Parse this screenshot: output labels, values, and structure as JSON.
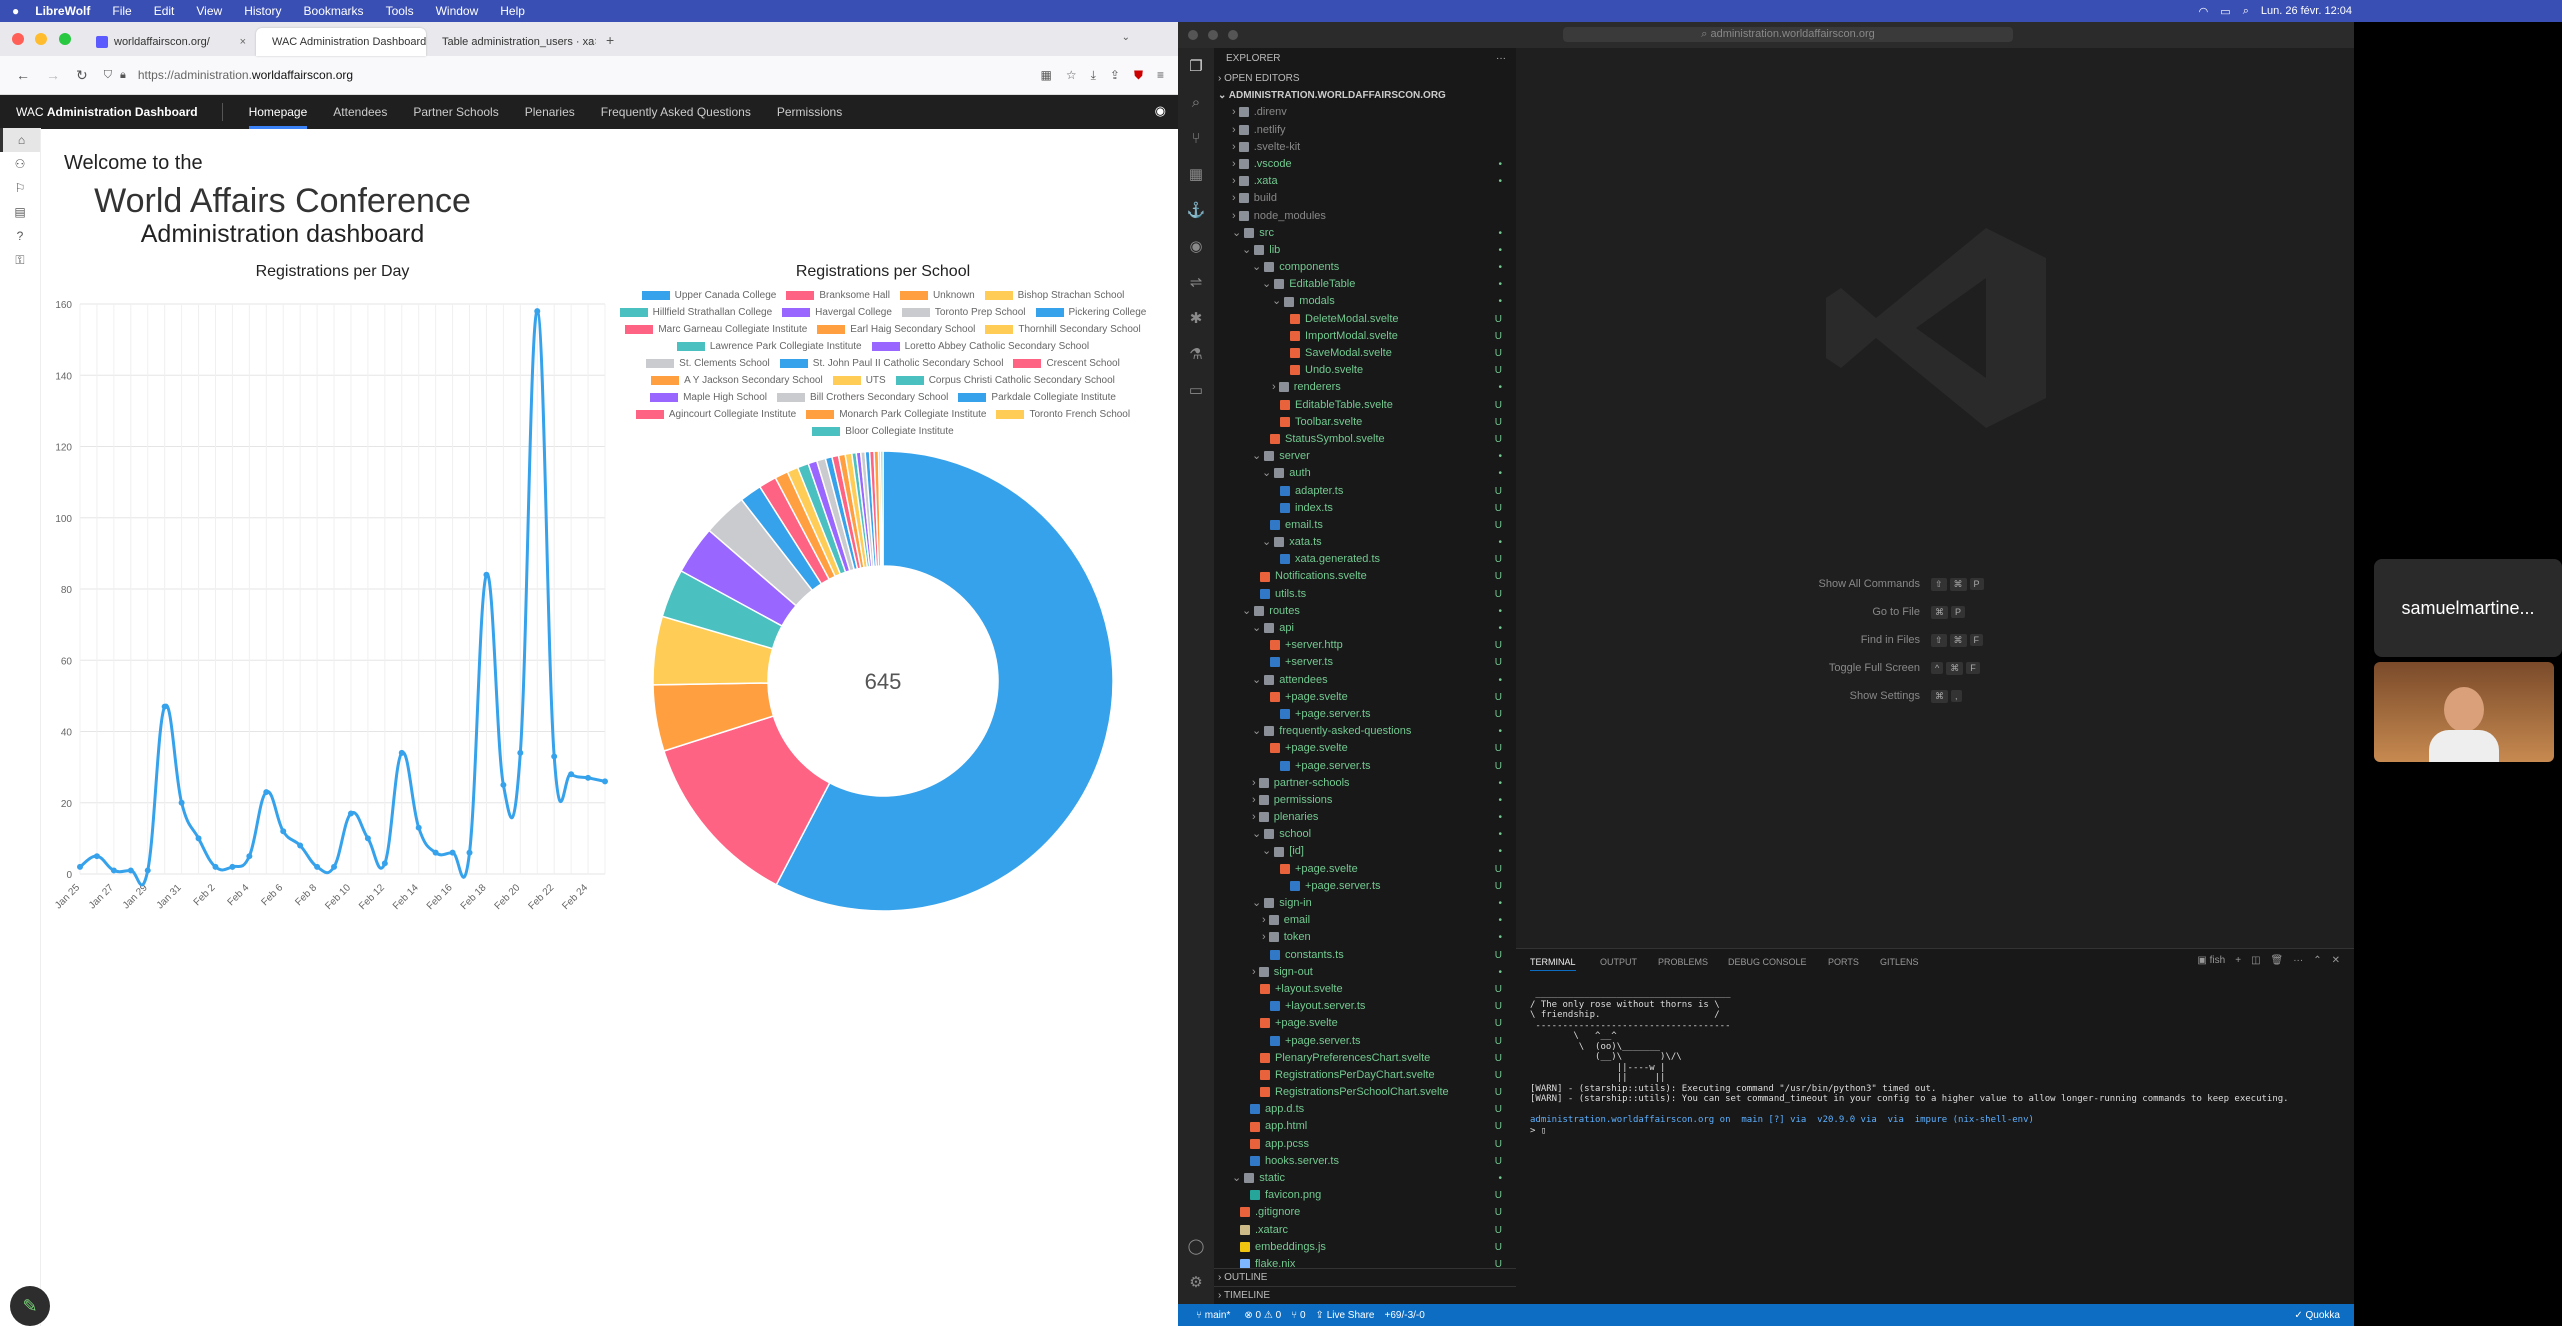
{
  "menubar": {
    "app": "LibreWolf",
    "items": [
      "File",
      "Edit",
      "View",
      "History",
      "Bookmarks",
      "Tools",
      "Window",
      "Help"
    ],
    "clock": "Lun. 26 févr. 12:04"
  },
  "browser": {
    "tabs": [
      {
        "title": "worldaffairscon.org/",
        "active": false
      },
      {
        "title": "WAC Administration Dashboard",
        "active": true
      },
      {
        "title": "Table administration_users · xa",
        "active": false
      }
    ],
    "url_prefix": "https://administration.",
    "url_domain": "worldaffairscon.org"
  },
  "app": {
    "brand_prefix": "WAC ",
    "brand_bold": "Administration Dashboard",
    "nav": [
      "Homepage",
      "Attendees",
      "Partner Schools",
      "Plenaries",
      "Frequently Asked Questions",
      "Permissions"
    ],
    "welcome": "Welcome to the",
    "conference": "World Affairs Conference",
    "dashboard": "Administration dashboard"
  },
  "chart_data": [
    {
      "type": "line",
      "title": "Registrations per Day",
      "x": [
        "Jan 25",
        "Jan 26",
        "Jan 27",
        "Jan 28",
        "Jan 29",
        "Jan 30",
        "Jan 31",
        "Feb 1",
        "Feb 2",
        "Feb 3",
        "Feb 4",
        "Feb 5",
        "Feb 6",
        "Feb 7",
        "Feb 8",
        "Feb 9",
        "Feb 10",
        "Feb 11",
        "Feb 12",
        "Feb 13",
        "Feb 14",
        "Feb 15",
        "Feb 16",
        "Feb 17",
        "Feb 18",
        "Feb 19",
        "Feb 20",
        "Feb 21",
        "Feb 22",
        "Feb 23",
        "Feb 24",
        "Feb 25"
      ],
      "x_tick_labels": [
        "Jan 25",
        "Jan 27",
        "Jan 29",
        "Jan 31",
        "Feb 2",
        "Feb 4",
        "Feb 6",
        "Feb 8",
        "Feb 10",
        "Feb 12",
        "Feb 14",
        "Feb 16",
        "Feb 18",
        "Feb 20",
        "Feb 22",
        "Feb 24"
      ],
      "values": [
        2,
        5,
        1,
        1,
        1,
        47,
        20,
        10,
        2,
        2,
        5,
        23,
        12,
        8,
        2,
        2,
        17,
        10,
        3,
        34,
        13,
        6,
        6,
        6,
        84,
        25,
        34,
        158,
        33,
        28,
        27,
        26
      ],
      "y_ticks": [
        "0",
        "20",
        "40",
        "60",
        "80",
        "100",
        "120",
        "140",
        "160"
      ],
      "ylim": [
        0,
        160
      ]
    },
    {
      "type": "pie",
      "title": "Registrations per School",
      "center_label": "645",
      "legend": [
        {
          "name": "Upper Canada College",
          "color": "#36a2eb",
          "value": 372
        },
        {
          "name": "Branksome Hall",
          "color": "#ff6384",
          "value": 80
        },
        {
          "name": "Unknown",
          "color": "#ff9f40",
          "value": 30
        },
        {
          "name": "Bishop Strachan School",
          "color": "#ffcd56",
          "value": 31
        },
        {
          "name": "Hillfield Strathallan College",
          "color": "#4bc0c0",
          "value": 22
        },
        {
          "name": "Havergal College",
          "color": "#9966ff",
          "value": 22
        },
        {
          "name": "Toronto Prep School",
          "color": "#c9cbcf",
          "value": 20
        },
        {
          "name": "Pickering College",
          "color": "#36a2eb",
          "value": 10
        },
        {
          "name": "Marc Garneau Collegiate Institute",
          "color": "#ff6384",
          "value": 8
        },
        {
          "name": "Earl Haig Secondary School",
          "color": "#ff9f40",
          "value": 6
        },
        {
          "name": "Thornhill Secondary School",
          "color": "#ffcd56",
          "value": 5
        },
        {
          "name": "Lawrence Park Collegiate Institute",
          "color": "#4bc0c0",
          "value": 5
        },
        {
          "name": "Loretto Abbey Catholic Secondary School",
          "color": "#9966ff",
          "value": 4
        },
        {
          "name": "St. Clements School",
          "color": "#c9cbcf",
          "value": 4
        },
        {
          "name": "St. John Paul II Catholic Secondary School",
          "color": "#36a2eb",
          "value": 3
        },
        {
          "name": "Crescent School",
          "color": "#ff6384",
          "value": 3
        },
        {
          "name": "A Y Jackson Secondary School",
          "color": "#ff9f40",
          "value": 3
        },
        {
          "name": "UTS",
          "color": "#ffcd56",
          "value": 3
        },
        {
          "name": "Corpus Christi Catholic Secondary School",
          "color": "#4bc0c0",
          "value": 2
        },
        {
          "name": "Maple High School",
          "color": "#9966ff",
          "value": 2
        },
        {
          "name": "Bill Crothers Secondary School",
          "color": "#c9cbcf",
          "value": 2
        },
        {
          "name": "Parkdale Collegiate Institute",
          "color": "#36a2eb",
          "value": 2
        },
        {
          "name": "Agincourt Collegiate Institute",
          "color": "#ff6384",
          "value": 2
        },
        {
          "name": "Monarch Park Collegiate Institute",
          "color": "#ff9f40",
          "value": 2
        },
        {
          "name": "Toronto French School",
          "color": "#ffcd56",
          "value": 1
        },
        {
          "name": "Bloor Collegiate Institute",
          "color": "#4bc0c0",
          "value": 1
        }
      ]
    }
  ],
  "vscode": {
    "title": "administration.worldaffairscon.org",
    "explorer_header": "EXPLORER",
    "open_editors": "OPEN EDITORS",
    "project": "ADMINISTRATION.WORLDAFFAIRSCON.ORG",
    "tree": [
      {
        "n": ".direnv",
        "d": 1,
        "f": true,
        "s": ""
      },
      {
        "n": ".netlify",
        "d": 1,
        "f": true,
        "s": ""
      },
      {
        "n": ".svelte-kit",
        "d": 1,
        "f": true,
        "s": ""
      },
      {
        "n": ".vscode",
        "d": 1,
        "f": true,
        "s": "•"
      },
      {
        "n": ".xata",
        "d": 1,
        "f": true,
        "s": "•"
      },
      {
        "n": "build",
        "d": 1,
        "f": true,
        "s": ""
      },
      {
        "n": "node_modules",
        "d": 1,
        "f": true,
        "s": ""
      },
      {
        "n": "src",
        "d": 1,
        "f": true,
        "s": "•",
        "open": true
      },
      {
        "n": "lib",
        "d": 2,
        "f": true,
        "s": "•",
        "open": true
      },
      {
        "n": "components",
        "d": 3,
        "f": true,
        "s": "•",
        "open": true
      },
      {
        "n": "EditableTable",
        "d": 4,
        "f": true,
        "s": "•",
        "open": true
      },
      {
        "n": "modals",
        "d": 5,
        "f": true,
        "s": "•",
        "open": true
      },
      {
        "n": "DeleteModal.svelte",
        "d": 6,
        "s": "U",
        "c": "#e8623c"
      },
      {
        "n": "ImportModal.svelte",
        "d": 6,
        "s": "U",
        "c": "#e8623c"
      },
      {
        "n": "SaveModal.svelte",
        "d": 6,
        "s": "U",
        "c": "#e8623c"
      },
      {
        "n": "Undo.svelte",
        "d": 6,
        "s": "U",
        "c": "#e8623c"
      },
      {
        "n": "renderers",
        "d": 5,
        "f": true,
        "s": "•"
      },
      {
        "n": "EditableTable.svelte",
        "d": 5,
        "s": "U",
        "c": "#e8623c"
      },
      {
        "n": "Toolbar.svelte",
        "d": 5,
        "s": "U",
        "c": "#e8623c"
      },
      {
        "n": "StatusSymbol.svelte",
        "d": 4,
        "s": "U",
        "c": "#e8623c"
      },
      {
        "n": "server",
        "d": 3,
        "f": true,
        "s": "•",
        "open": true
      },
      {
        "n": "auth",
        "d": 4,
        "f": true,
        "s": "•",
        "open": true
      },
      {
        "n": "adapter.ts",
        "d": 5,
        "s": "U",
        "c": "#3178c6"
      },
      {
        "n": "index.ts",
        "d": 5,
        "s": "U",
        "c": "#3178c6"
      },
      {
        "n": "email.ts",
        "d": 4,
        "s": "U",
        "c": "#3178c6"
      },
      {
        "n": "xata.ts",
        "d": 4,
        "f": true,
        "s": "•",
        "open": true
      },
      {
        "n": "xata.generated.ts",
        "d": 5,
        "s": "U",
        "c": "#3178c6"
      },
      {
        "n": "Notifications.svelte",
        "d": 3,
        "s": "U",
        "c": "#e8623c"
      },
      {
        "n": "utils.ts",
        "d": 3,
        "s": "U",
        "c": "#3178c6"
      },
      {
        "n": "routes",
        "d": 2,
        "f": true,
        "s": "•",
        "open": true
      },
      {
        "n": "api",
        "d": 3,
        "f": true,
        "s": "•",
        "open": true
      },
      {
        "n": "+server.http",
        "d": 4,
        "s": "U",
        "c": "#e8623c"
      },
      {
        "n": "+server.ts",
        "d": 4,
        "s": "U",
        "c": "#3178c6"
      },
      {
        "n": "attendees",
        "d": 3,
        "f": true,
        "s": "•",
        "open": true
      },
      {
        "n": "+page.svelte",
        "d": 4,
        "s": "U",
        "c": "#e8623c"
      },
      {
        "n": "+page.server.ts",
        "d": 5,
        "s": "U",
        "c": "#3178c6"
      },
      {
        "n": "frequently-asked-questions",
        "d": 3,
        "f": true,
        "s": "•",
        "open": true
      },
      {
        "n": "+page.svelte",
        "d": 4,
        "s": "U",
        "c": "#e8623c"
      },
      {
        "n": "+page.server.ts",
        "d": 5,
        "s": "U",
        "c": "#3178c6"
      },
      {
        "n": "partner-schools",
        "d": 3,
        "f": true,
        "s": "•"
      },
      {
        "n": "permissions",
        "d": 3,
        "f": true,
        "s": "•"
      },
      {
        "n": "plenaries",
        "d": 3,
        "f": true,
        "s": "•"
      },
      {
        "n": "school",
        "d": 3,
        "f": true,
        "s": "•",
        "open": true
      },
      {
        "n": "[id]",
        "d": 4,
        "f": true,
        "s": "•",
        "open": true
      },
      {
        "n": "+page.svelte",
        "d": 5,
        "s": "U",
        "c": "#e8623c"
      },
      {
        "n": "+page.server.ts",
        "d": 6,
        "s": "U",
        "c": "#3178c6"
      },
      {
        "n": "sign-in",
        "d": 3,
        "f": true,
        "s": "•",
        "open": true
      },
      {
        "n": "email",
        "d": 4,
        "f": true,
        "s": "•"
      },
      {
        "n": "token",
        "d": 4,
        "f": true,
        "s": "•"
      },
      {
        "n": "constants.ts",
        "d": 4,
        "s": "U",
        "c": "#3178c6"
      },
      {
        "n": "sign-out",
        "d": 3,
        "f": true,
        "s": "•"
      },
      {
        "n": "+layout.svelte",
        "d": 3,
        "s": "U",
        "c": "#e8623c"
      },
      {
        "n": "+layout.server.ts",
        "d": 4,
        "s": "U",
        "c": "#3178c6"
      },
      {
        "n": "+page.svelte",
        "d": 3,
        "s": "U",
        "c": "#e8623c"
      },
      {
        "n": "+page.server.ts",
        "d": 4,
        "s": "U",
        "c": "#3178c6"
      },
      {
        "n": "PlenaryPreferencesChart.svelte",
        "d": 3,
        "s": "U",
        "c": "#e8623c"
      },
      {
        "n": "RegistrationsPerDayChart.svelte",
        "d": 3,
        "s": "U",
        "c": "#e8623c"
      },
      {
        "n": "RegistrationsPerSchoolChart.svelte",
        "d": 3,
        "s": "U",
        "c": "#e8623c"
      },
      {
        "n": "app.d.ts",
        "d": 2,
        "s": "U",
        "c": "#3178c6"
      },
      {
        "n": "app.html",
        "d": 2,
        "s": "U",
        "c": "#e8623c"
      },
      {
        "n": "app.pcss",
        "d": 2,
        "s": "U",
        "c": "#e8623c"
      },
      {
        "n": "hooks.server.ts",
        "d": 2,
        "s": "U",
        "c": "#3178c6"
      },
      {
        "n": "static",
        "d": 1,
        "f": true,
        "s": "•",
        "open": true
      },
      {
        "n": "favicon.png",
        "d": 2,
        "s": "U",
        "c": "#26a69a"
      },
      {
        "n": ".gitignore",
        "d": 1,
        "s": "U",
        "c": "#e8623c"
      },
      {
        "n": ".xatarc",
        "d": 1,
        "s": "U",
        "c": "#cb8"
      },
      {
        "n": "embeddings.js",
        "d": 1,
        "s": "U",
        "c": "#f1c40f"
      },
      {
        "n": "flake.nix",
        "d": 1,
        "s": "U",
        "c": "#7eb6ff"
      }
    ],
    "outline": "OUTLINE",
    "timeline": "TIMELINE",
    "shortcuts": [
      {
        "label": "Show All Commands",
        "keys": [
          "⇧",
          "⌘",
          "P"
        ]
      },
      {
        "label": "Go to File",
        "keys": [
          "⌘",
          "P"
        ]
      },
      {
        "label": "Find in Files",
        "keys": [
          "⇧",
          "⌘",
          "F"
        ]
      },
      {
        "label": "Toggle Full Screen",
        "keys": [
          "^",
          "⌘",
          "F"
        ]
      },
      {
        "label": "Show Settings",
        "keys": [
          "⌘",
          ","
        ]
      }
    ],
    "panel_tabs": [
      "TERMINAL",
      "OUTPUT",
      "PROBLEMS",
      "DEBUG CONSOLE",
      "PORTS",
      "GITLENS"
    ],
    "terminal_shell": "fish",
    "terminal_lines": [
      " ____________________________________",
      "/ The only rose without thorns is \\",
      "\\ friendship.                     /",
      " ------------------------------------",
      "        \\   ^__^",
      "         \\  (oo)\\_______",
      "            (__)\\       )\\/\\",
      "                ||----w |",
      "                ||     ||",
      "[WARN] - (starship::utils): Executing command \"/usr/bin/python3\" timed out.",
      "[WARN] - (starship::utils): You can set command_timeout in your config to a higher value to allow longer-running commands to keep executing.",
      "",
      "administration.worldaffairscon.org on  main [?] via  v20.9.0 via  via  impure (nix-shell-env)",
      "> ▯"
    ],
    "status_branch": "main*",
    "status_problems": "⊗ 0 ⚠ 0",
    "status_ports": "⑂ 0",
    "status_liveshare": "Live Share",
    "status_git": "+69/-3/-0",
    "status_quokka": "Quokka"
  },
  "meeting": {
    "participant_name": "samuelmartine..."
  }
}
